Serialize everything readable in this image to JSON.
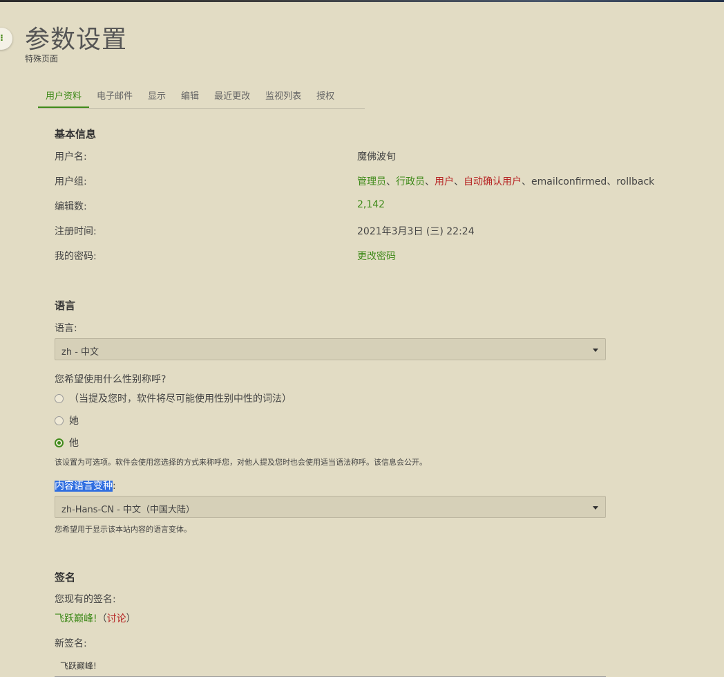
{
  "header": {
    "title": "参数设置",
    "subtitle": "特殊页面"
  },
  "tabs": [
    {
      "label": "用户资料",
      "active": true
    },
    {
      "label": "电子邮件"
    },
    {
      "label": "显示"
    },
    {
      "label": "编辑"
    },
    {
      "label": "最近更改"
    },
    {
      "label": "监视列表"
    },
    {
      "label": "授权"
    }
  ],
  "basic_info": {
    "title": "基本信息",
    "username_label": "用户名:",
    "username_value": "魔佛波旬",
    "groups_label": "用户组:",
    "groups": {
      "admin": "管理员",
      "sep1": "、",
      "bureaucrat": "行政员",
      "sep2": "、",
      "user": "用户",
      "sep3": "、",
      "autoconfirmed": "自动确认用户",
      "rest": "、emailconfirmed、rollback"
    },
    "edits_label": "编辑数:",
    "edits_value": "2,142",
    "registered_label": "注册时间:",
    "registered_value": "2021年3月3日 (三) 22:24",
    "password_label": "我的密码:",
    "password_link": "更改密码"
  },
  "language": {
    "title": "语言",
    "lang_label": "语言:",
    "lang_selected": "zh - 中文",
    "gender_question": "您希望使用什么性别称呼?",
    "gender_options": [
      {
        "label": "（当提及您时，软件将尽可能使用性别中性的词法）",
        "checked": false
      },
      {
        "label": "她",
        "checked": false
      },
      {
        "label": "他",
        "checked": true
      }
    ],
    "gender_hint": "该设置为可选项。软件会使用您选择的方式来称呼您，对他人提及您时也会使用适当语法称呼。该信息会公开。",
    "variant_label": "内容语言变种",
    "variant_colon": ":",
    "variant_selected": "zh-Hans-CN - 中文（中国大陆）",
    "variant_hint": "您希望用于显示该本站内容的语言变体。"
  },
  "signature": {
    "title": "签名",
    "current_label": "您现有的签名:",
    "current_sig": "飞跃巅峰!",
    "talk_open": "（",
    "talk_link": "讨论",
    "talk_close": "）",
    "new_label": "新签名:",
    "new_value": "飞跃巅峰!"
  },
  "colors": {
    "background": "#e2dcc4",
    "link_green": "#3f8a1a",
    "link_red": "#b62323",
    "selection": "#2f6ee0"
  }
}
